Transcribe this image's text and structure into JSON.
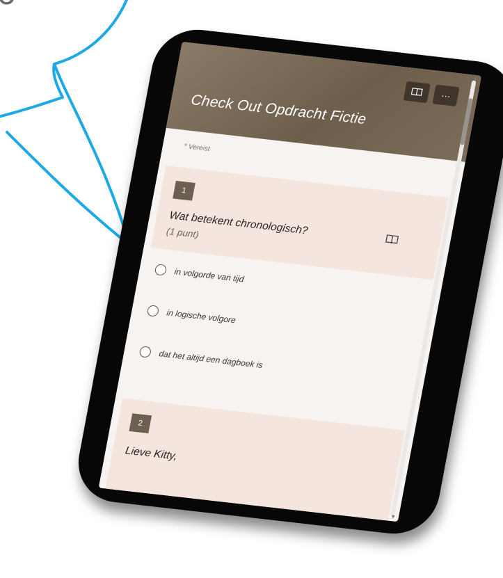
{
  "bubble": {
    "text": "o"
  },
  "form": {
    "title": "Check Out Opdracht Fictie",
    "required_note": "* Vereist",
    "header_tools": {
      "reader_icon": "immersive-reader-icon",
      "more_label": "···"
    }
  },
  "questions": [
    {
      "number": "1",
      "text": "Wat betekent chronologisch?",
      "points": "(1 punt)",
      "reader_icon": "immersive-reader-icon",
      "options": [
        "in volgorde van tijd",
        "in logische volgore",
        "dat het altijd een dagboek is"
      ]
    },
    {
      "number": "2",
      "text": "Lieve Kitty,"
    }
  ],
  "colors": {
    "header": "#6e5f4d",
    "panel": "#f4e6de",
    "bubble_stroke": "#1ea8e6",
    "number_badge": "#6d5f51"
  }
}
